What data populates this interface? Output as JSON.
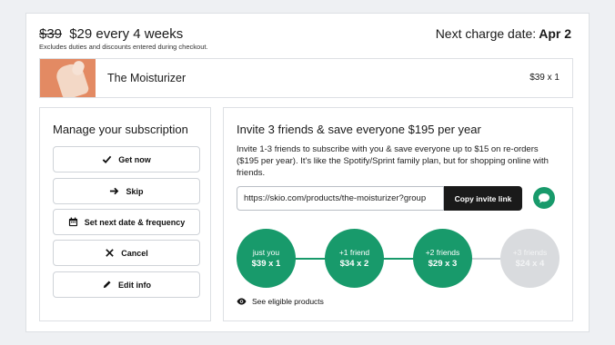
{
  "header": {
    "price_old": "$39",
    "price_new": "$29 every 4 weeks",
    "disclaimer": "Excludes duties and discounts entered during checkout.",
    "next_charge_label": "Next charge date:",
    "next_charge_date": "Apr 2"
  },
  "product": {
    "name": "The Moisturizer",
    "qty": "$39 x 1"
  },
  "manage": {
    "title": "Manage your subscription",
    "buttons": [
      {
        "label": "Get now",
        "icon": "check-icon"
      },
      {
        "label": "Skip",
        "icon": "arrow-right-icon"
      },
      {
        "label": "Set next date & frequency",
        "icon": "calendar-icon"
      },
      {
        "label": "Cancel",
        "icon": "x-icon"
      },
      {
        "label": "Edit info",
        "icon": "pencil-icon"
      }
    ]
  },
  "invite": {
    "title": "Invite 3 friends & save everyone $195 per year",
    "description": "Invite 1-3 friends to subscribe with you & save everyone up to $15 on re-orders ($195 per year). It's like the Spotify/Sprint family plan, but for shopping online with friends.",
    "url": "https://skio.com/products/the-moisturizer?group",
    "copy_label": "Copy invite link",
    "tiers": [
      {
        "label": "just you",
        "price": "$39 x 1",
        "active": true
      },
      {
        "label": "+1 friend",
        "price": "$34 x 2",
        "active": true
      },
      {
        "label": "+2 friends",
        "price": "$29 x 3",
        "active": true
      },
      {
        "label": "+3 friends",
        "price": "$24 x 4",
        "active": false
      }
    ],
    "eligible_label": "See eligible products"
  },
  "colors": {
    "accent": "#189a6b",
    "dark": "#1a1a1a",
    "inactive": "#d9dbde",
    "thumb": "#e38a63"
  }
}
